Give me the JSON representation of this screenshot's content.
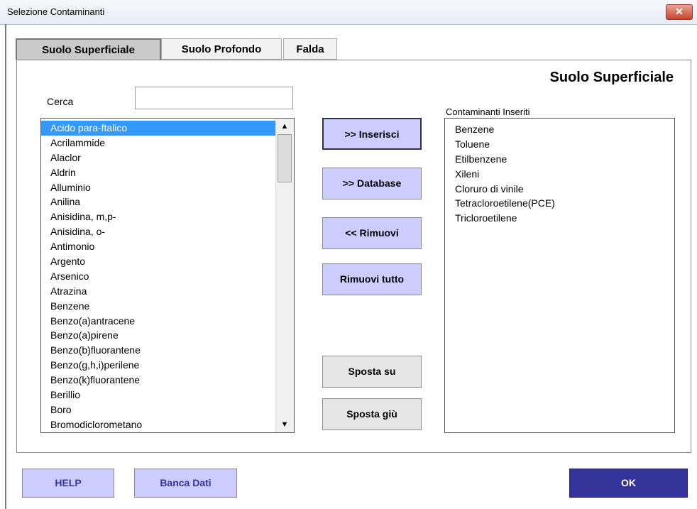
{
  "window": {
    "title": "Selezione Contaminanti",
    "close_label": "✕"
  },
  "tabs": [
    {
      "label": "Suolo Superficiale",
      "active": true
    },
    {
      "label": "Suolo Profondo",
      "active": false
    },
    {
      "label": "Falda",
      "active": false
    }
  ],
  "section_title": "Suolo Superficiale",
  "search": {
    "label": "Cerca",
    "value": ""
  },
  "available_list": {
    "items": [
      "Acido para-ftalico",
      "Acrilammide",
      "Alaclor",
      "Aldrin",
      "Alluminio",
      "Anilina",
      "Anisidina, m,p-",
      "Anisidina, o-",
      "Antimonio",
      "Argento",
      "Arsenico",
      "Atrazina",
      "Benzene",
      "Benzo(a)antracene",
      "Benzo(a)pirene",
      "Benzo(b)fluorantene",
      "Benzo(g,h,i)perilene",
      "Benzo(k)fluorantene",
      "Berillio",
      "Boro",
      "Bromodiclorometano"
    ],
    "selected_index": 0
  },
  "scrollbar": {
    "up_icon": "scroll-up-arrow-icon",
    "down_icon": "scroll-down-arrow-icon",
    "up_glyph": "▲",
    "down_glyph": "▼"
  },
  "buttons": {
    "inserisci": ">> Inserisci",
    "database": ">> Database",
    "rimuovi": "<< Rimuovi",
    "rimuovi_tutto": "Rimuovi tutto",
    "sposta_su": "Sposta su",
    "sposta_giu": "Sposta giù"
  },
  "inserted": {
    "label": "Contaminanti Inseriti",
    "items": [
      "Benzene",
      "Toluene",
      "Etilbenzene",
      "Xileni",
      "Cloruro di vinile",
      "Tetracloroetilene(PCE)",
      "Tricloroetilene"
    ]
  },
  "bottom": {
    "help": "HELP",
    "banca_dati": "Banca Dati",
    "ok": "OK"
  },
  "colors": {
    "button_purple": "#ccccff",
    "ok_blue": "#333399",
    "selection": "#3399ff",
    "close_red": "#c7432c"
  }
}
